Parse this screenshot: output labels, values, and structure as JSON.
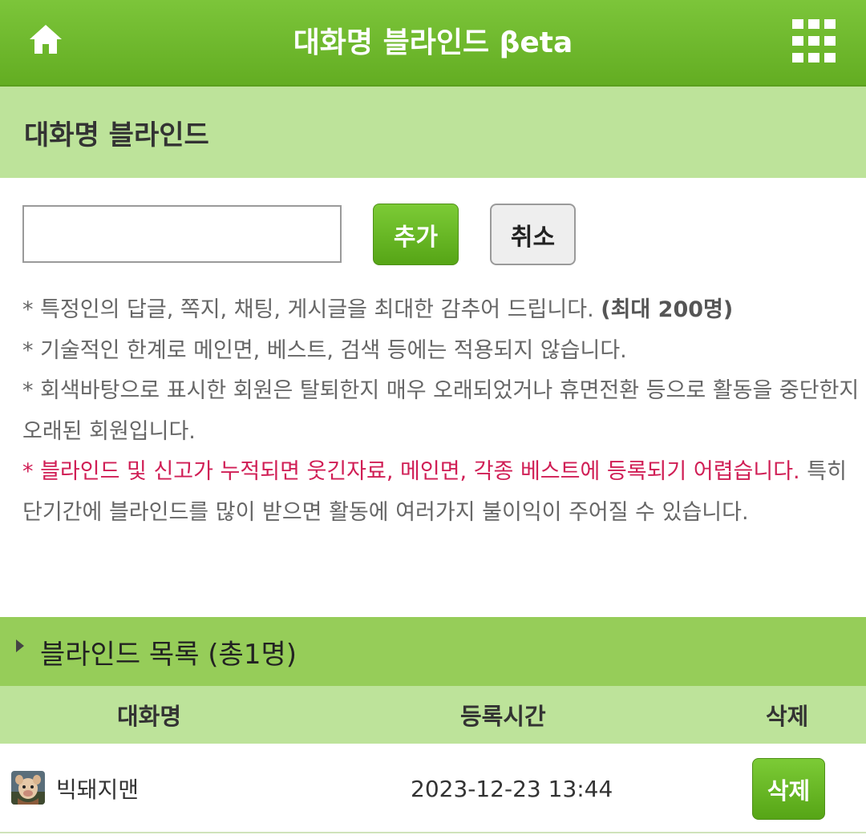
{
  "header": {
    "title": "대화명 블라인드 βeta",
    "home_icon": "home-icon",
    "menu_icon": "grid-menu-icon"
  },
  "section": {
    "title": "대화명 블라인드"
  },
  "form": {
    "input_value": "",
    "add_label": "추가",
    "cancel_label": "취소"
  },
  "notes": {
    "line1_text": "* 특정인의 답글, 쪽지, 채팅, 게시글을 최대한 감추어 드립니다. ",
    "line1_bold": "(최대 200명)",
    "line2": "* 기술적인 한계로 메인면, 베스트, 검색 등에는 적용되지 않습니다.",
    "line3": "* 회색바탕으로 표시한 회원은 탈퇴한지 매우 오래되었거나 휴면전환 등으로 활동을 중단한지 오래된 회원입니다.",
    "line4_red": "* 블라인드 및 신고가 누적되면 웃긴자료, 메인면, 각종 베스트에 등록되기 어렵습니다.",
    "line4_rest": " 특히 단기간에 블라인드를 많이 받으면 활동에 여러가지 불이익이 주어질 수 있습니다."
  },
  "list": {
    "title": "블라인드 목록 (총1명)",
    "columns": [
      "대화명",
      "등록시간",
      "삭제"
    ],
    "rows": [
      {
        "nickname": "빅돼지맨",
        "registered": "2023-12-23 13:44",
        "delete_label": "삭제"
      }
    ]
  },
  "colors": {
    "header_green": "#6ab82a",
    "section_bg": "#bde39a",
    "list_head_bg": "#96cd59",
    "warning_red": "#d01e55"
  }
}
